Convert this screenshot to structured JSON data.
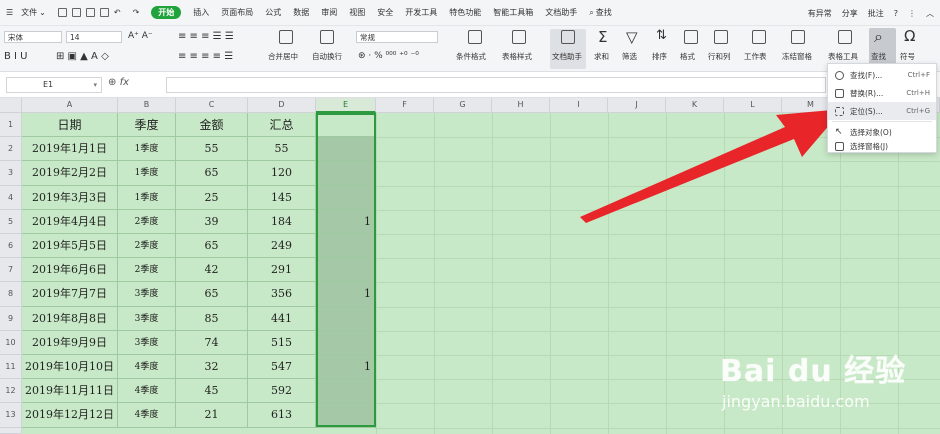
{
  "menu": {
    "file": "文件",
    "tabs": [
      "开始",
      "插入",
      "页面布局",
      "公式",
      "数据",
      "审阅",
      "视图",
      "安全",
      "开发工具",
      "特色功能",
      "智能工具箱",
      "文档助手"
    ],
    "search": "查找",
    "right": [
      "有异常",
      "分享",
      "批注"
    ]
  },
  "ribbon": {
    "font_name": "宋体",
    "font_size": "14",
    "merge_center": "合并居中",
    "wrap_text": "自动换行",
    "number_format": "常规",
    "cond_format": "条件格式",
    "table_style": "表格样式",
    "doc_helper": "文档助手",
    "sum": "求和",
    "filter": "筛选",
    "sort": "排序",
    "format": "格式",
    "row_col": "行和列",
    "worksheet": "工作表",
    "freeze": "冻结窗格",
    "table_tools": "表格工具",
    "find": "查找",
    "symbol": "符号"
  },
  "formula_bar": {
    "name_box": "E1",
    "fx": "fx"
  },
  "columns": [
    "A",
    "B",
    "C",
    "D",
    "E",
    "F",
    "G",
    "H",
    "I",
    "J",
    "K",
    "L",
    "M"
  ],
  "table": {
    "headers": [
      "日期",
      "季度",
      "金额",
      "汇总"
    ],
    "rows": [
      {
        "date": "2019年1月1日",
        "quarter": "1季度",
        "amount": "55",
        "total": "55",
        "e": ""
      },
      {
        "date": "2019年2月2日",
        "quarter": "1季度",
        "amount": "65",
        "total": "120",
        "e": ""
      },
      {
        "date": "2019年3月3日",
        "quarter": "1季度",
        "amount": "25",
        "total": "145",
        "e": ""
      },
      {
        "date": "2019年4月4日",
        "quarter": "2季度",
        "amount": "39",
        "total": "184",
        "e": "1"
      },
      {
        "date": "2019年5月5日",
        "quarter": "2季度",
        "amount": "65",
        "total": "249",
        "e": ""
      },
      {
        "date": "2019年6月6日",
        "quarter": "2季度",
        "amount": "42",
        "total": "291",
        "e": ""
      },
      {
        "date": "2019年7月7日",
        "quarter": "3季度",
        "amount": "65",
        "total": "356",
        "e": "1"
      },
      {
        "date": "2019年8月8日",
        "quarter": "3季度",
        "amount": "85",
        "total": "441",
        "e": ""
      },
      {
        "date": "2019年9月9日",
        "quarter": "3季度",
        "amount": "74",
        "total": "515",
        "e": ""
      },
      {
        "date": "2019年10月10日",
        "quarter": "4季度",
        "amount": "32",
        "total": "547",
        "e": "1"
      },
      {
        "date": "2019年11月11日",
        "quarter": "4季度",
        "amount": "45",
        "total": "592",
        "e": ""
      },
      {
        "date": "2019年12月12日",
        "quarter": "4季度",
        "amount": "21",
        "total": "613",
        "e": ""
      }
    ]
  },
  "dropdown": {
    "items": [
      {
        "label": "查找(F)...",
        "shortcut": "Ctrl+F"
      },
      {
        "label": "替换(R)...",
        "shortcut": "Ctrl+H"
      },
      {
        "label": "定位(S)...",
        "shortcut": "Ctrl+G"
      },
      {
        "label": "选择对象(O)",
        "shortcut": ""
      },
      {
        "label": "选择窗格(J)",
        "shortcut": ""
      }
    ]
  },
  "watermark": {
    "brand": "Bai du 经验",
    "url": "jingyan.baidu.com"
  },
  "colors": {
    "accent": "#1fa33a",
    "sheet_bg": "#c8e9c7",
    "arrow": "#e8262a"
  }
}
